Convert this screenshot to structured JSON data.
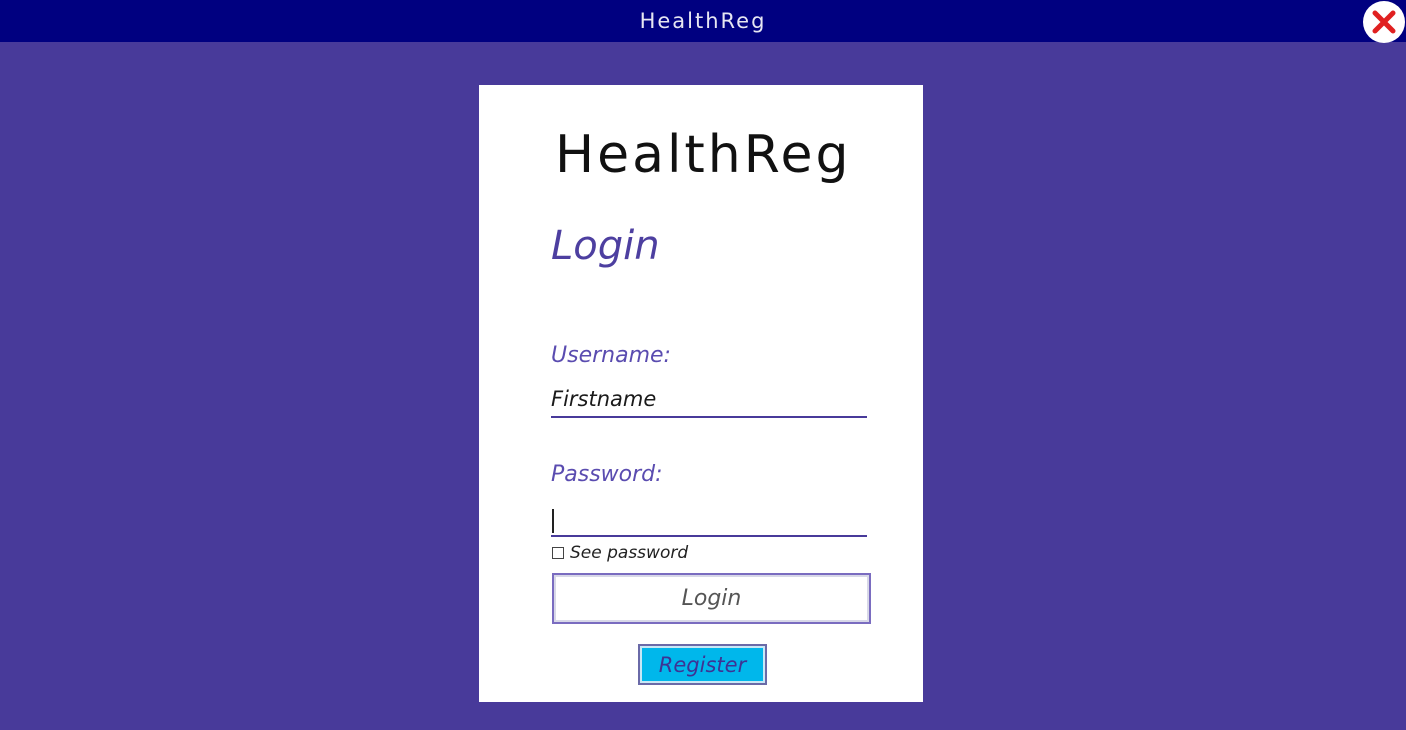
{
  "window": {
    "title": "HealthReg",
    "close_icon": "close-x-icon",
    "close_icon_color": "#e02020",
    "titlebar_color": "#000080",
    "background_color": "#483a9a"
  },
  "card": {
    "app_title": "HealthReg",
    "heading": "Login",
    "username": {
      "label": "Username:",
      "value": "Firstname"
    },
    "password": {
      "label": "Password:",
      "value": ""
    },
    "see_password": {
      "label": "See password",
      "checked": false
    },
    "login_button": "Login",
    "register_button": "Register",
    "register_color": "#00b7eb"
  }
}
